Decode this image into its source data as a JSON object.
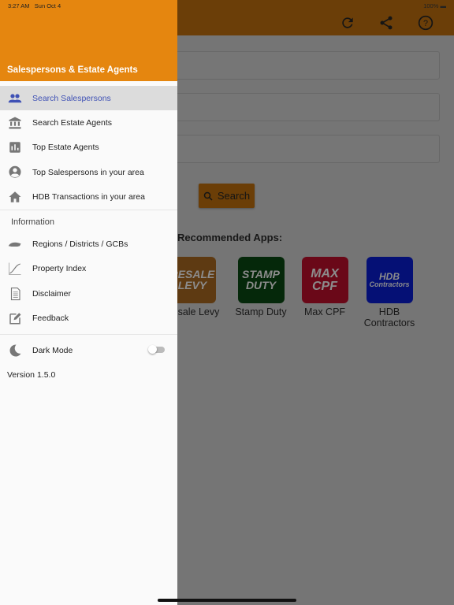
{
  "status_bar": {
    "time": "3:27 AM",
    "date": "Sun Oct 4",
    "battery": "100%"
  },
  "colors": {
    "accent": "#e5860f",
    "selected_text": "#3f51b5"
  },
  "main": {
    "header_icons": [
      "refresh-icon",
      "share-icon",
      "help-icon"
    ],
    "search_label": "Search",
    "recommended_label": "Recommended Apps:",
    "apps": [
      {
        "tile": "RESALE LEVY",
        "label": "Resale Levy",
        "color": "#b06a1f"
      },
      {
        "tile": "STAMP DUTY",
        "label": "Stamp Duty",
        "color": "#0a4d12"
      },
      {
        "tile": "MAX CPF",
        "label": "Max CPF",
        "color": "#c8102e"
      },
      {
        "tile_top": "HDB",
        "tile_bottom": "Contractors",
        "label": "HDB Contractors",
        "color": "#0a1f9c"
      }
    ]
  },
  "drawer": {
    "title": "Salespersons & Estate Agents",
    "items": [
      {
        "label": "Search Salespersons",
        "icon": "people-icon",
        "selected": true
      },
      {
        "label": "Search Estate Agents",
        "icon": "bank-icon"
      },
      {
        "label": "Top Estate Agents",
        "icon": "bar-chart-icon"
      },
      {
        "label": "Top Salespersons in your area",
        "icon": "account-pin-icon"
      },
      {
        "label": "HDB Transactions in your area",
        "icon": "home-icon"
      }
    ],
    "section": "Information",
    "info_items": [
      {
        "label": "Regions / Districts / GCBs",
        "icon": "map-icon"
      },
      {
        "label": "Property Index",
        "icon": "line-chart-icon"
      },
      {
        "label": "Disclaimer",
        "icon": "document-icon"
      },
      {
        "label": "Feedback",
        "icon": "edit-icon"
      }
    ],
    "dark_mode": {
      "label": "Dark Mode",
      "on": false
    },
    "version": "Version 1.5.0"
  }
}
